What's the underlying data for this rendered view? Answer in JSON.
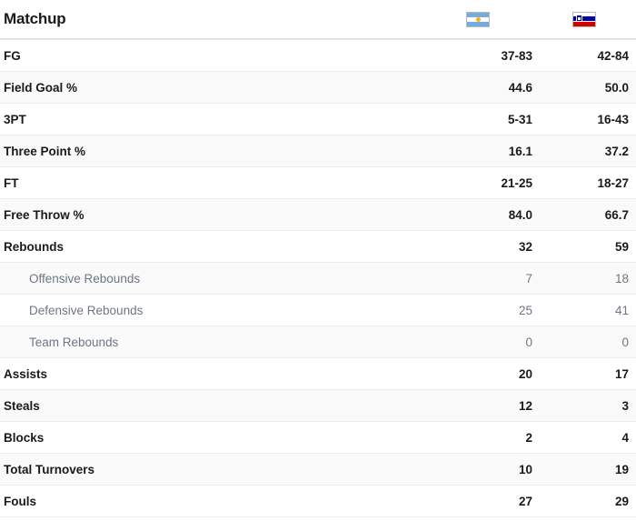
{
  "header": {
    "title": "Matchup",
    "teams": [
      {
        "name": "Argentina",
        "flag_icon": "argentina-flag-icon",
        "colors": {
          "light_blue": "#74acdf",
          "white": "#ffffff",
          "sun": "#f6b40e"
        }
      },
      {
        "name": "Slovenia",
        "flag_icon": "slovenia-flag-icon",
        "colors": {
          "white": "#ffffff",
          "blue": "#0000a0",
          "red": "#d50000"
        }
      }
    ]
  },
  "theme": {
    "row_bg": "#ffffff",
    "row_bg_alt": "#fafafa",
    "divider": "#ededed",
    "header_divider": "#e3e3e3",
    "text": "#1a1a1a",
    "text_muted": "#6e7783"
  },
  "stats": [
    {
      "label": "FG",
      "team_a": "37-83",
      "team_b": "42-84",
      "sub": false
    },
    {
      "label": "Field Goal %",
      "team_a": "44.6",
      "team_b": "50.0",
      "sub": false
    },
    {
      "label": "3PT",
      "team_a": "5-31",
      "team_b": "16-43",
      "sub": false
    },
    {
      "label": "Three Point %",
      "team_a": "16.1",
      "team_b": "37.2",
      "sub": false
    },
    {
      "label": "FT",
      "team_a": "21-25",
      "team_b": "18-27",
      "sub": false
    },
    {
      "label": "Free Throw %",
      "team_a": "84.0",
      "team_b": "66.7",
      "sub": false
    },
    {
      "label": "Rebounds",
      "team_a": "32",
      "team_b": "59",
      "sub": false
    },
    {
      "label": "Offensive Rebounds",
      "team_a": "7",
      "team_b": "18",
      "sub": true
    },
    {
      "label": "Defensive Rebounds",
      "team_a": "25",
      "team_b": "41",
      "sub": true
    },
    {
      "label": "Team Rebounds",
      "team_a": "0",
      "team_b": "0",
      "sub": true
    },
    {
      "label": "Assists",
      "team_a": "20",
      "team_b": "17",
      "sub": false
    },
    {
      "label": "Steals",
      "team_a": "12",
      "team_b": "3",
      "sub": false
    },
    {
      "label": "Blocks",
      "team_a": "2",
      "team_b": "4",
      "sub": false
    },
    {
      "label": "Total Turnovers",
      "team_a": "10",
      "team_b": "19",
      "sub": false
    },
    {
      "label": "Fouls",
      "team_a": "27",
      "team_b": "29",
      "sub": false
    }
  ]
}
